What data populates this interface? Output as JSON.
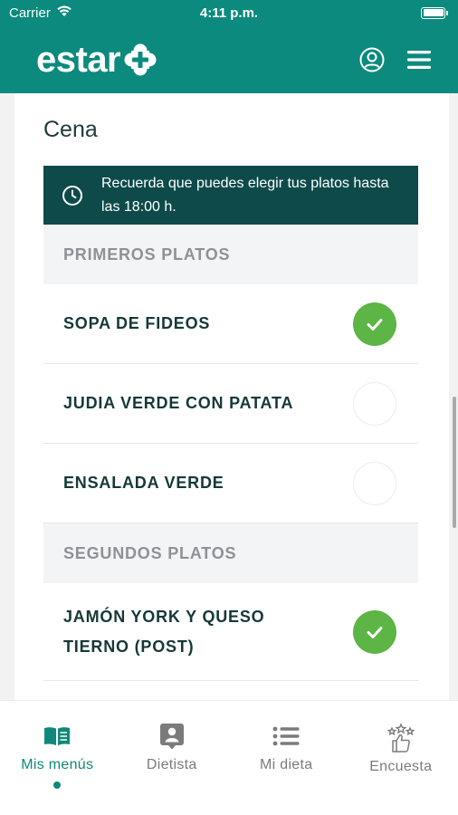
{
  "status_bar": {
    "carrier": "Carrier",
    "time": "4:11 p.m."
  },
  "header": {
    "logo_text": "estar"
  },
  "section": {
    "title": "Cena",
    "notice": "Recuerda que puedes elegir tus platos hasta las 18:00 h."
  },
  "categories": [
    {
      "title": "PRIMEROS PLATOS",
      "items": [
        {
          "label": "SOPA DE FIDEOS",
          "selected": true
        },
        {
          "label": "JUDIA VERDE CON PATATA",
          "selected": false
        },
        {
          "label": "ENSALADA VERDE",
          "selected": false
        }
      ]
    },
    {
      "title": "SEGUNDOS PLATOS",
      "items": [
        {
          "label": "JAMÓN YORK Y QUESO TIERNO (POST)",
          "selected": true
        }
      ]
    }
  ],
  "tabs": [
    {
      "label": "Mis menús",
      "icon": "book-icon",
      "active": true
    },
    {
      "label": "Dietista",
      "icon": "dietitian-icon",
      "active": false
    },
    {
      "label": "Mi dieta",
      "icon": "list-icon",
      "active": false
    },
    {
      "label": "Encuesta",
      "icon": "survey-icon",
      "active": false
    }
  ],
  "colors": {
    "brand": "#0b8a7d",
    "notice_bg": "#0e4a4a",
    "selected": "#5cb544",
    "active_tab": "#10887b"
  }
}
